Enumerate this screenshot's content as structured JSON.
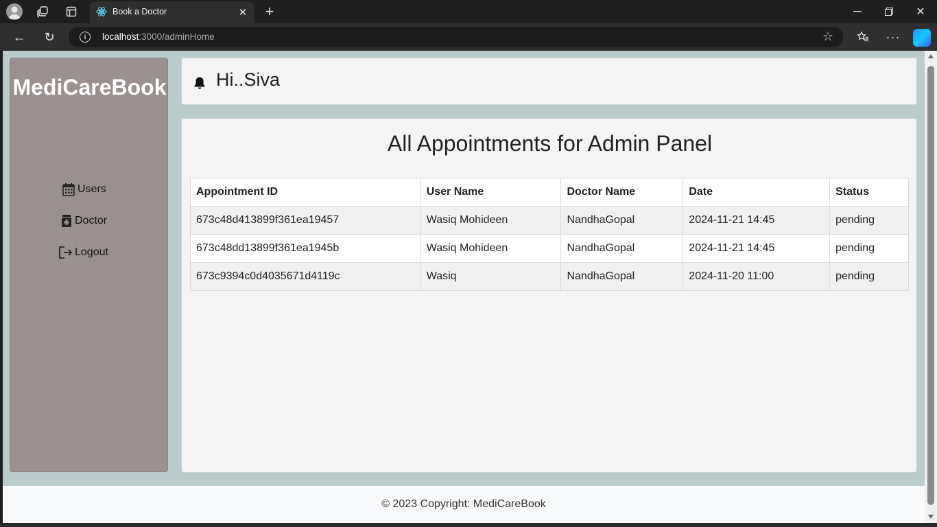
{
  "browser": {
    "tab_title": "Book a Doctor",
    "url_host": "localhost",
    "url_path": ":3000/adminHome",
    "tab_close": "✕",
    "new_tab": "+",
    "close": "✕",
    "back": "←",
    "reload": "↻",
    "star": "☆",
    "more": "···"
  },
  "sidebar": {
    "brand": "MediCareBook",
    "items": [
      {
        "label": "Users",
        "icon": "calendar-icon"
      },
      {
        "label": "Doctor",
        "icon": "medicine-bottle-icon"
      },
      {
        "label": "Logout",
        "icon": "logout-icon"
      }
    ]
  },
  "header": {
    "greeting": "Hi..Siva",
    "icon": "bell-icon"
  },
  "main": {
    "title": "All Appointments for Admin Panel",
    "table": {
      "columns": [
        "Appointment ID",
        "User Name",
        "Doctor Name",
        "Date",
        "Status"
      ],
      "rows": [
        [
          "673c48d413899f361ea19457",
          "Wasiq Mohideen",
          "NandhaGopal",
          "2024-11-21 14:45",
          "pending"
        ],
        [
          "673c48dd13899f361ea1945b",
          "Wasiq Mohideen",
          "NandhaGopal",
          "2024-11-21 14:45",
          "pending"
        ],
        [
          "673c9394c0d4035671d4119c",
          "Wasiq",
          "NandhaGopal",
          "2024-11-20 11:00",
          "pending"
        ]
      ]
    }
  },
  "footer": {
    "text": "© 2023 Copyright: MediCareBook"
  },
  "colors": {
    "sidebar_bg": "#9b9090",
    "page_bg": "#bccbcc",
    "card_bg": "#f4f4f4"
  }
}
